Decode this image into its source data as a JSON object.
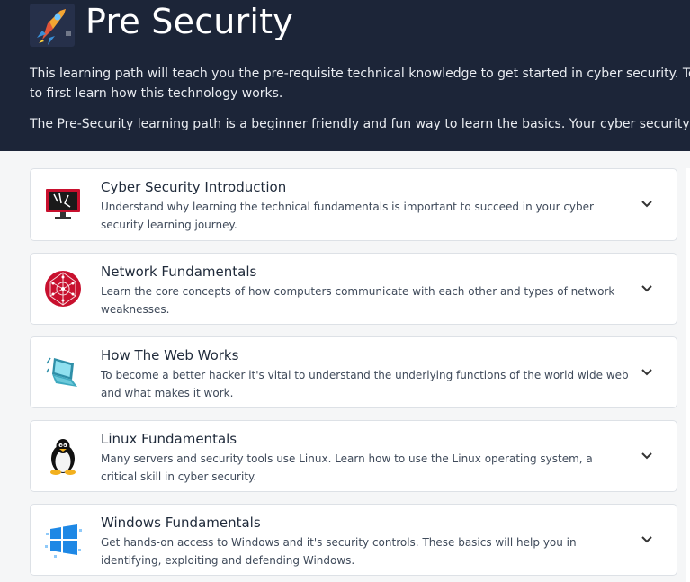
{
  "header": {
    "title": "Pre Security",
    "intro_line1": "This learning path will teach you the pre-requisite technical knowledge to get started in cyber security. To attack or defend any technology, you have",
    "intro_line2": "to first learn how this technology works.",
    "intro_para2": "The Pre-Security learning path is a beginner friendly and fun way to learn the basics. Your cyber security learning journey begins here!",
    "logo_icon": "rocket-icon"
  },
  "modules": [
    {
      "title": "Cyber Security Introduction",
      "description": "Understand why learning the technical fundamentals is important to succeed in your cyber security learning journey.",
      "icon": "computer-monitor-icon"
    },
    {
      "title": "Network Fundamentals",
      "description": "Learn the core concepts of how computers communicate with each other and types of network weaknesses.",
      "icon": "network-globe-icon"
    },
    {
      "title": "How The Web Works",
      "description": "To become a better hacker it's vital to understand the underlying functions of the world wide web and what makes it work.",
      "icon": "laptop-icon"
    },
    {
      "title": "Linux Fundamentals",
      "description": "Many servers and security tools use Linux. Learn how to use the Linux operating system, a critical skill in cyber security.",
      "icon": "linux-penguin-icon"
    },
    {
      "title": "Windows Fundamentals",
      "description": "Get hands-on access to Windows and it's security controls. These basics will help you in identifying, exploiting and defending Windows.",
      "icon": "windows-logo-icon"
    }
  ],
  "colors": {
    "header_bg": "#1c2538",
    "card_bg": "#ffffff",
    "page_bg": "#f5f6f7",
    "accent_red": "#c8102e"
  }
}
